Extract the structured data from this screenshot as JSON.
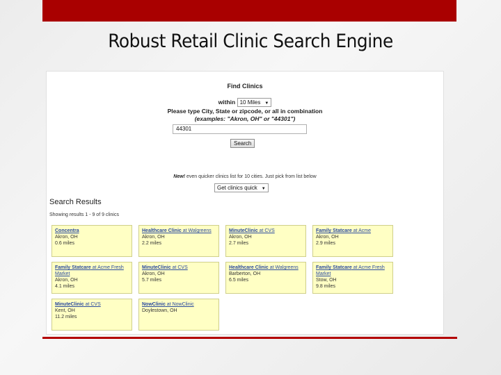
{
  "slide": {
    "title": "Robust Retail Clinic Search Engine"
  },
  "finder": {
    "title": "Find Clinics",
    "within_label": "within",
    "distance_selected": "10 Miles",
    "instruction": "Please type City, State or zipcode, or all in combination",
    "examples": "(examples: \"Akron, OH\" or \"44301\")",
    "query_value": "44301",
    "search_label": "Search",
    "new_badge": "New!",
    "new_text": " even quicker clinics list for 10 cities. Just pick from list below",
    "quick_select_value": "Get clinics quick"
  },
  "results": {
    "heading": "Search Results",
    "showing": "Showing results 1 - 9 of 9 clinics",
    "clinics": [
      {
        "name_bold": "Concentra",
        "name_rest": "",
        "location": "Akron, OH",
        "distance": "0.6 miles"
      },
      {
        "name_bold": "Healthcare Clinic",
        "name_rest": " at Walgreens",
        "location": "Akron, OH",
        "distance": "2.2 miles"
      },
      {
        "name_bold": "MinuteClinic",
        "name_rest": " at CVS",
        "location": "Akron, OH",
        "distance": "2.7 miles"
      },
      {
        "name_bold": "Family Statcare",
        "name_rest": " at Acme",
        "location": "Akron, OH",
        "distance": "2.9 miles"
      },
      {
        "name_bold": "Family Statcare",
        "name_rest": " at Acme Fresh Market",
        "location": "Akron, OH",
        "distance": "4.1 miles"
      },
      {
        "name_bold": "MinuteClinic",
        "name_rest": " at CVS",
        "location": "Akron, OH",
        "distance": "5.7 miles"
      },
      {
        "name_bold": "Healthcare Clinic",
        "name_rest": " at Walgreens",
        "location": "Barberton, OH",
        "distance": "6.5 miles"
      },
      {
        "name_bold": "Family Statcare",
        "name_rest": " at Acme Fresh Market",
        "location": "Stow, OH",
        "distance": "9.8 miles"
      },
      {
        "name_bold": "MinuteClinic",
        "name_rest": " at CVS",
        "location": "Kent, OH",
        "distance": "11.2 miles"
      },
      {
        "name_bold": "NowClinic",
        "name_rest": " at NowClinic",
        "location": "Doylestown, OH",
        "distance": ""
      }
    ]
  },
  "colors": {
    "accent": "#a90000",
    "card_bg": "#ffffc4",
    "link": "#2a4a9e"
  }
}
